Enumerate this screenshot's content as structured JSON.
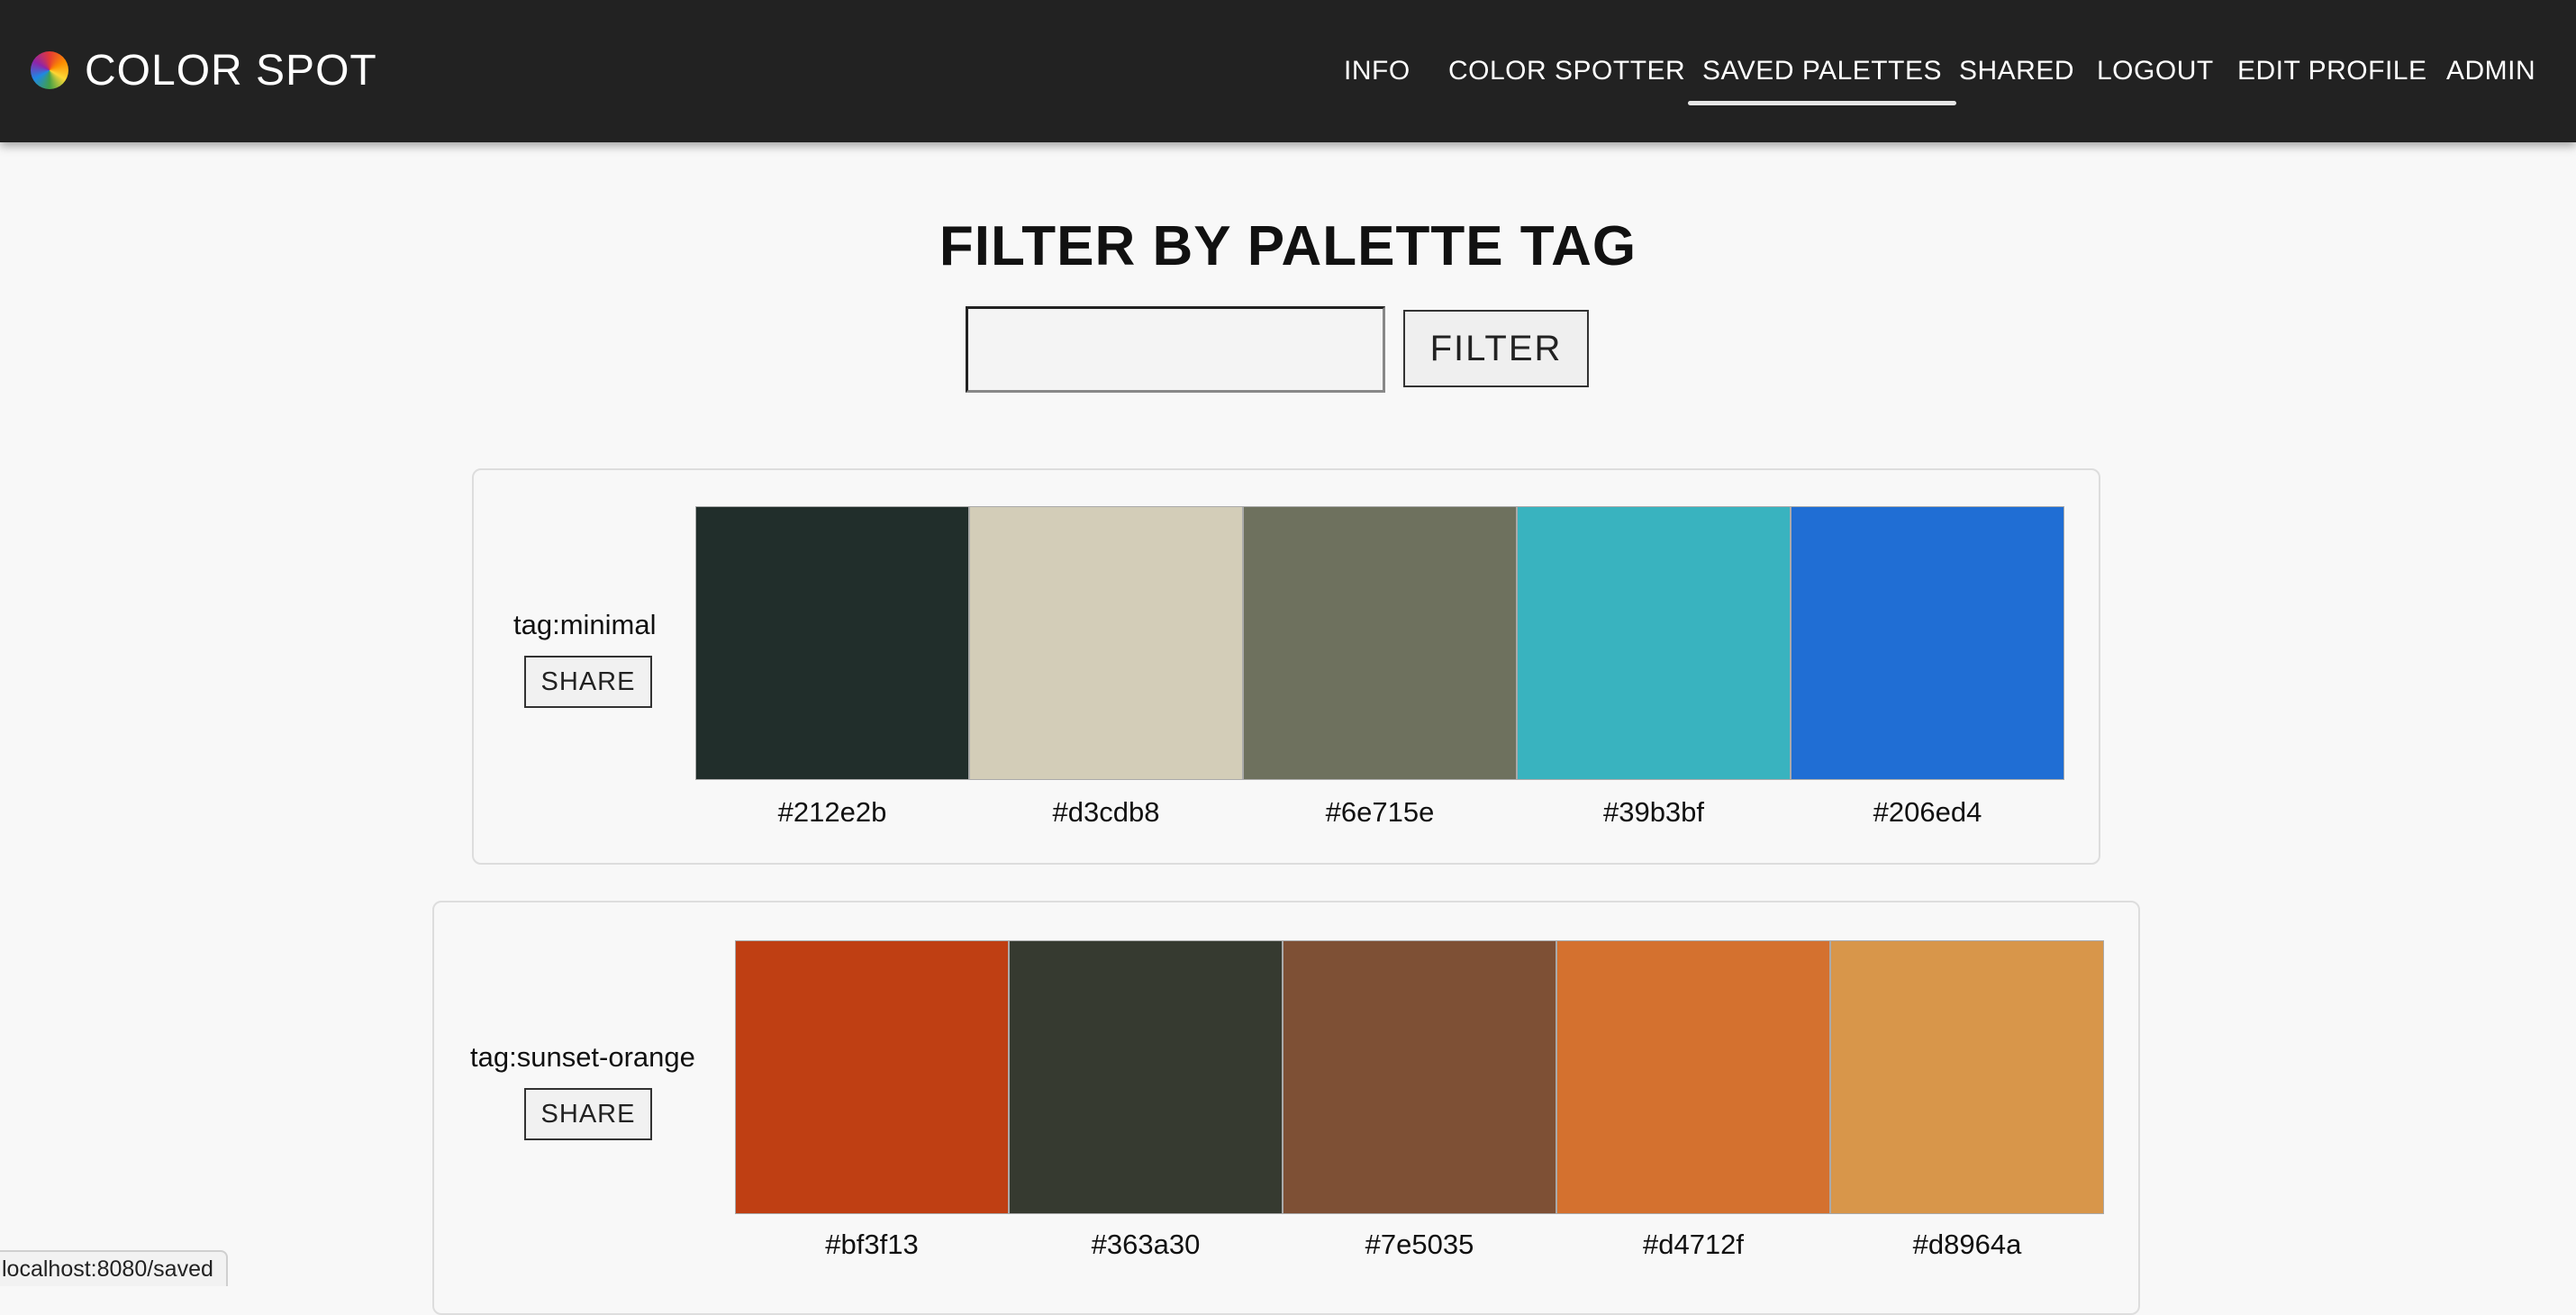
{
  "brand": {
    "name": "COLOR SPOT",
    "logo_icon": "color-wheel-icon"
  },
  "nav": {
    "info": "INFO",
    "color_spotter": "COLOR SPOTTER",
    "saved_palettes": "SAVED PALETTES",
    "shared": "SHARED",
    "logout": "LOGOUT",
    "edit_profile": "EDIT PROFILE",
    "admin": "ADMIN",
    "active": "SAVED PALETTES"
  },
  "filter": {
    "title": "FILTER BY PALETTE TAG",
    "input_value": "",
    "button_label": "FILTER"
  },
  "palettes": [
    {
      "tag": "tag:minimal",
      "share_label": "SHARE",
      "colors": [
        "#212e2b",
        "#d3cdb8",
        "#6e715e",
        "#39b3bf",
        "#206ed4"
      ]
    },
    {
      "tag": "tag:sunset-orange",
      "share_label": "SHARE",
      "colors": [
        "#bf3f13",
        "#363a30",
        "#7e5035",
        "#d4712f",
        "#d8964a"
      ]
    }
  ],
  "status_bar": {
    "url": "localhost:8080/saved"
  }
}
